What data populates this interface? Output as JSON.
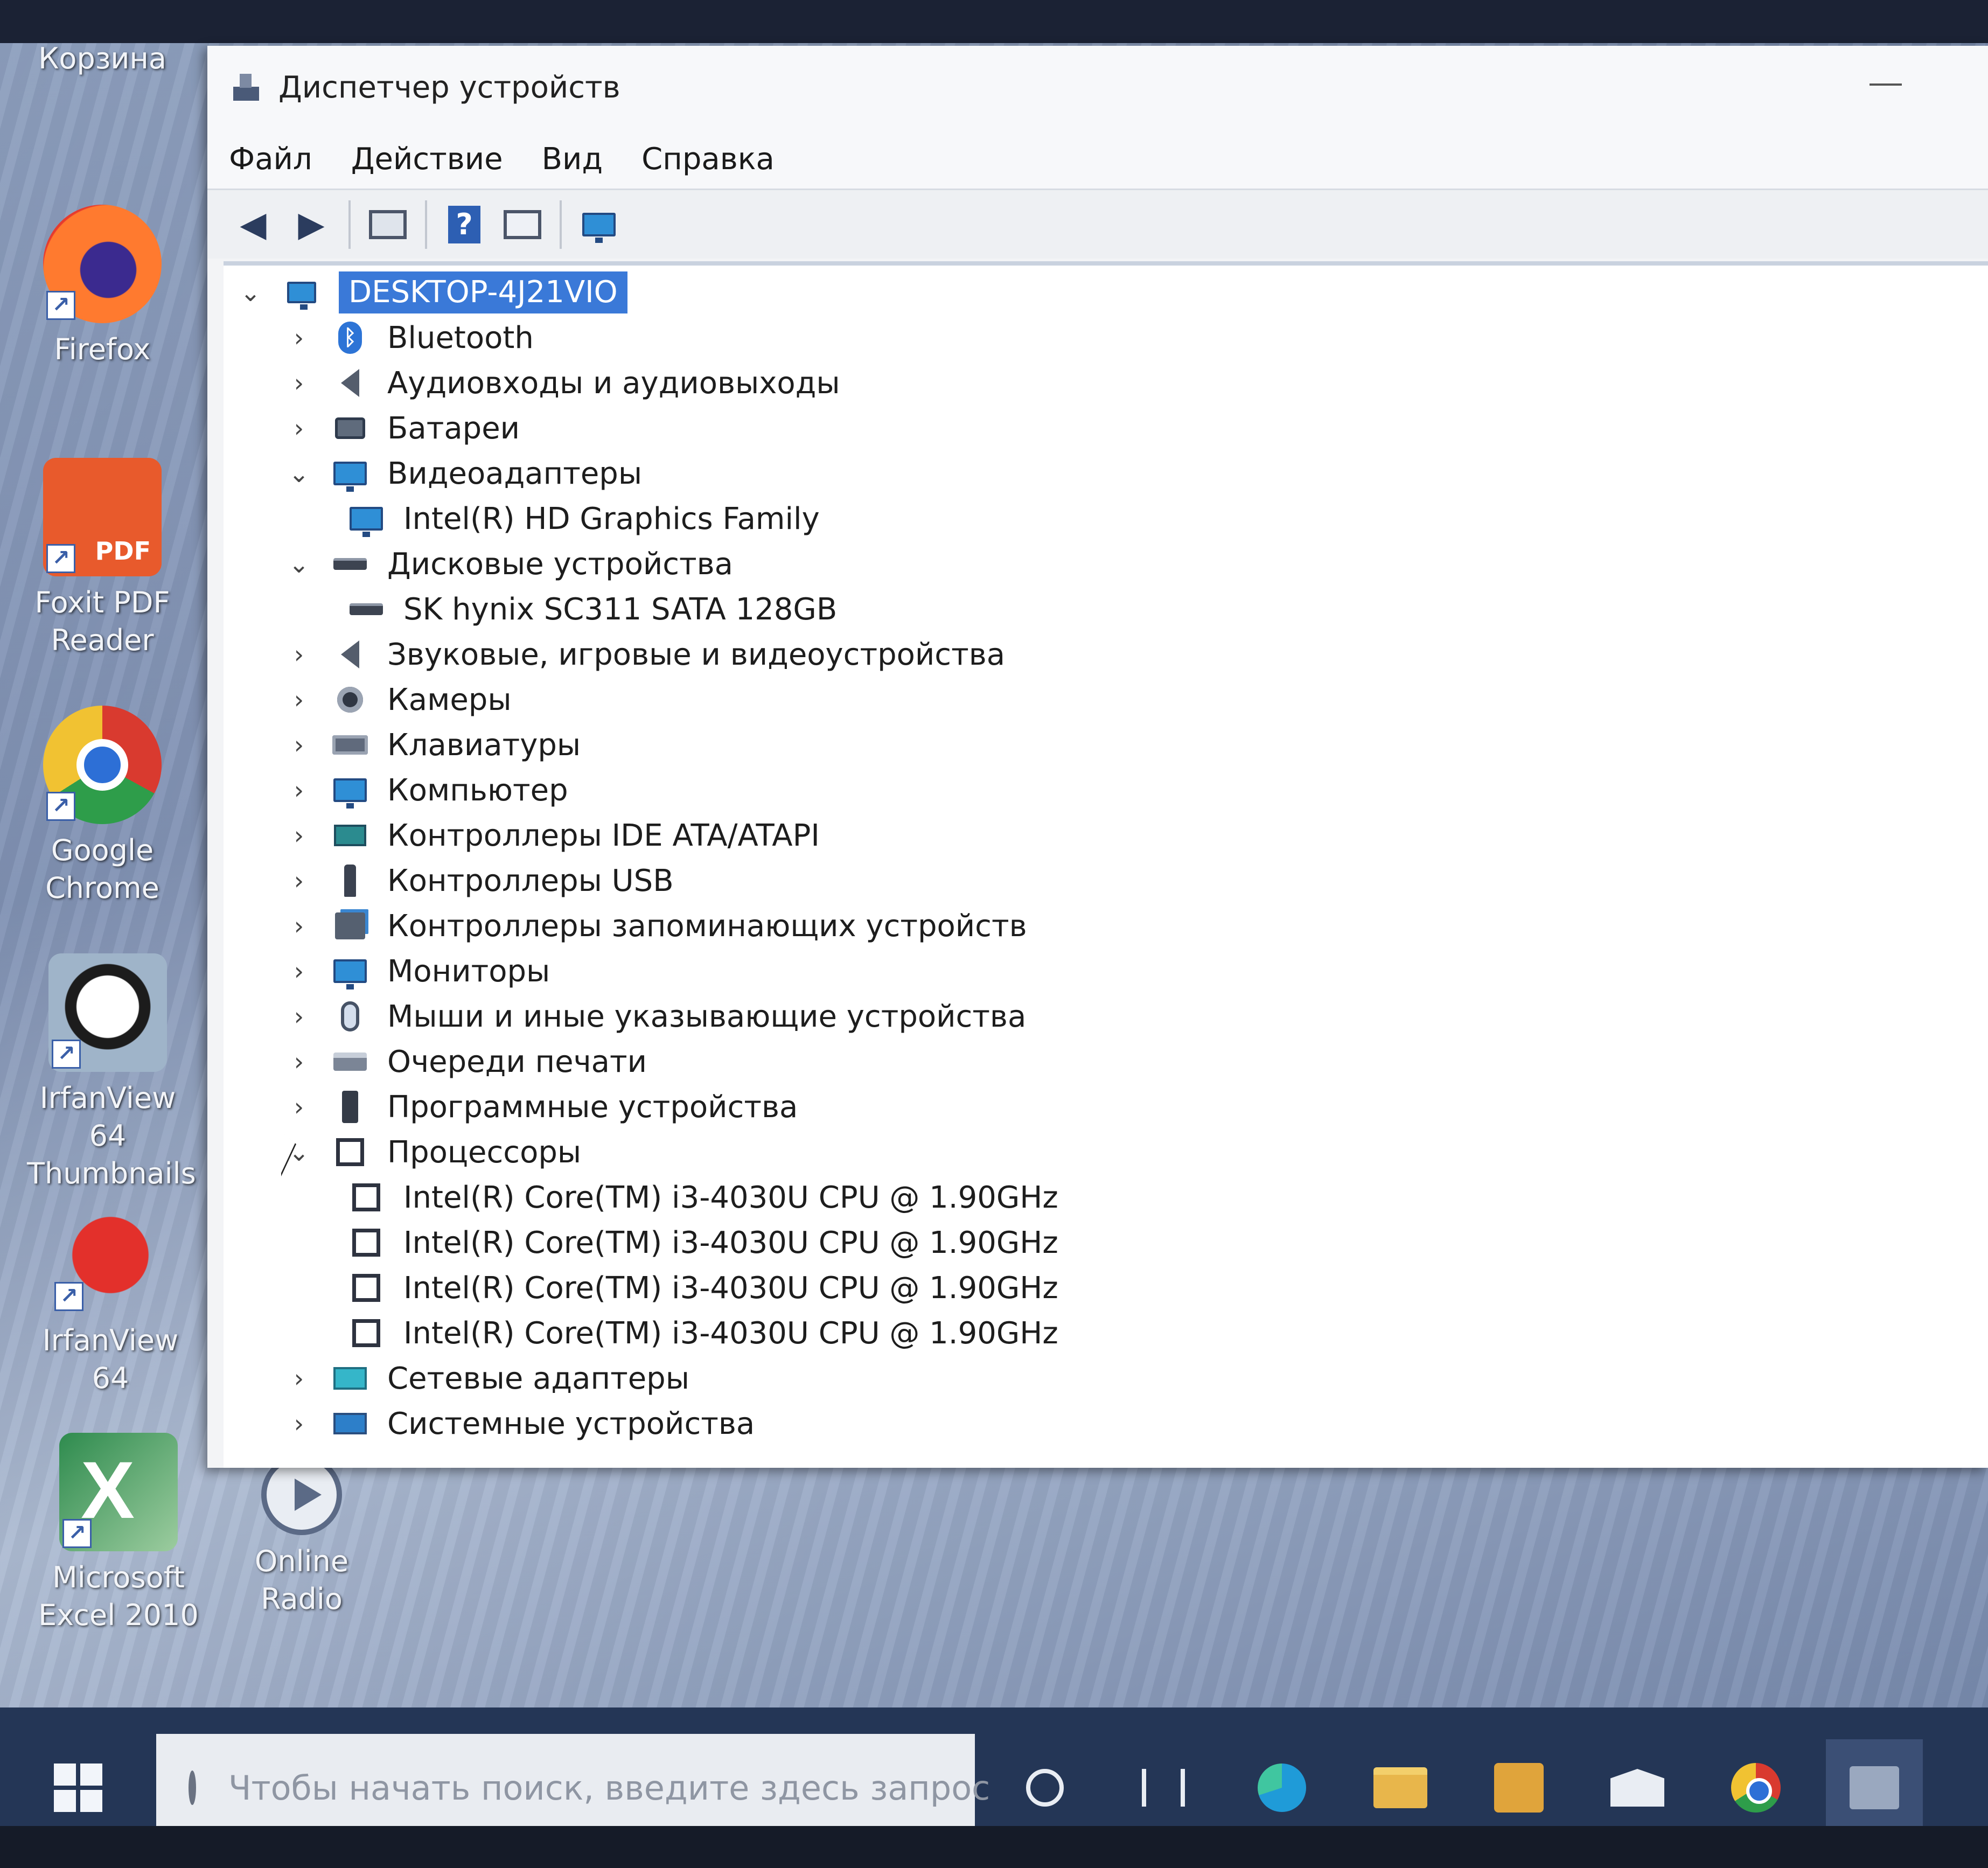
{
  "desktop": {
    "icons": [
      {
        "label": "Корзина",
        "icon": "recycle-bin-icon"
      },
      {
        "label": "Firefox",
        "icon": "firefox-icon"
      },
      {
        "label": "Foxit PDF Reader",
        "icon": "foxit-pdf-icon",
        "badge": "PDF"
      },
      {
        "label": "Google Chrome",
        "icon": "chrome-icon"
      },
      {
        "label": "IrfanView 64 Thumbnails",
        "icon": "irfanview-thumbnails-icon"
      },
      {
        "label": "IrfanView 64",
        "icon": "irfanview-icon"
      },
      {
        "label": "Microsoft Excel 2010",
        "icon": "excel-icon"
      },
      {
        "label": "Online Radio",
        "icon": "online-radio-icon"
      }
    ]
  },
  "window": {
    "title": "Диспетчер устройств",
    "menu": [
      "Файл",
      "Действие",
      "Вид",
      "Справка"
    ],
    "toolbar": [
      "back-icon",
      "forward-icon",
      "properties-icon",
      "help-icon",
      "view-icon",
      "monitor-icon"
    ],
    "tree": {
      "root": "DESKTOP-4J21VIO",
      "rows": [
        {
          "label": "Bluetooth",
          "expander": "collapsed",
          "icon": "bluetooth-icon",
          "level": 1
        },
        {
          "label": "Аудиовходы и аудиовыходы",
          "expander": "collapsed",
          "icon": "speaker-icon",
          "level": 1
        },
        {
          "label": "Батареи",
          "expander": "collapsed",
          "icon": "battery-icon",
          "level": 1
        },
        {
          "label": "Видеоадаптеры",
          "expander": "expanded",
          "icon": "display-adapter-icon",
          "level": 1
        },
        {
          "label": "Intel(R) HD Graphics Family",
          "expander": "none",
          "icon": "display-adapter-icon",
          "level": 2
        },
        {
          "label": "Дисковые устройства",
          "expander": "expanded",
          "icon": "disk-drive-icon",
          "level": 1
        },
        {
          "label": "SK hynix SC311 SATA 128GB",
          "expander": "none",
          "icon": "disk-drive-icon",
          "level": 2
        },
        {
          "label": "Звуковые, игровые и видеоустройства",
          "expander": "collapsed",
          "icon": "sound-icon",
          "level": 1
        },
        {
          "label": "Камеры",
          "expander": "collapsed",
          "icon": "camera-icon",
          "level": 1
        },
        {
          "label": "Клавиатуры",
          "expander": "collapsed",
          "icon": "keyboard-icon",
          "level": 1
        },
        {
          "label": "Компьютер",
          "expander": "collapsed",
          "icon": "computer-icon",
          "level": 1
        },
        {
          "label": "Контроллеры IDE ATA/ATAPI",
          "expander": "collapsed",
          "icon": "ide-controller-icon",
          "level": 1
        },
        {
          "label": "Контроллеры USB",
          "expander": "collapsed",
          "icon": "usb-icon",
          "level": 1
        },
        {
          "label": "Контроллеры запоминающих устройств",
          "expander": "collapsed",
          "icon": "storage-controller-icon",
          "level": 1
        },
        {
          "label": "Мониторы",
          "expander": "collapsed",
          "icon": "monitor-icon",
          "level": 1
        },
        {
          "label": "Мыши и иные указывающие устройства",
          "expander": "collapsed",
          "icon": "mouse-icon",
          "level": 1
        },
        {
          "label": "Очереди печати",
          "expander": "collapsed",
          "icon": "printer-icon",
          "level": 1
        },
        {
          "label": "Программные устройства",
          "expander": "collapsed",
          "icon": "software-device-icon",
          "level": 1
        },
        {
          "label": "Процессоры",
          "expander": "expanded",
          "icon": "processor-icon",
          "level": 1
        },
        {
          "label": "Intel(R) Core(TM) i3-4030U CPU @ 1.90GHz",
          "expander": "none",
          "icon": "processor-icon",
          "level": 2
        },
        {
          "label": "Intel(R) Core(TM) i3-4030U CPU @ 1.90GHz",
          "expander": "none",
          "icon": "processor-icon",
          "level": 2
        },
        {
          "label": "Intel(R) Core(TM) i3-4030U CPU @ 1.90GHz",
          "expander": "none",
          "icon": "processor-icon",
          "level": 2
        },
        {
          "label": "Intel(R) Core(TM) i3-4030U CPU @ 1.90GHz",
          "expander": "none",
          "icon": "processor-icon",
          "level": 2
        },
        {
          "label": "Сетевые адаптеры",
          "expander": "collapsed",
          "icon": "network-adapter-icon",
          "level": 1
        },
        {
          "label": "Системные устройства",
          "expander": "collapsed",
          "icon": "system-device-icon",
          "level": 1
        }
      ]
    }
  },
  "taskbar": {
    "search_placeholder": "Чтобы начать поиск, введите здесь запрос",
    "items": [
      "cortana-icon",
      "task-view-icon",
      "edge-icon",
      "file-explorer-icon",
      "store-icon",
      "mail-icon",
      "chrome-icon",
      "device-manager-icon"
    ]
  },
  "colors": {
    "selection": "#3a79d8",
    "taskbar": "#243656",
    "window_bg": "#f3f4f6"
  }
}
